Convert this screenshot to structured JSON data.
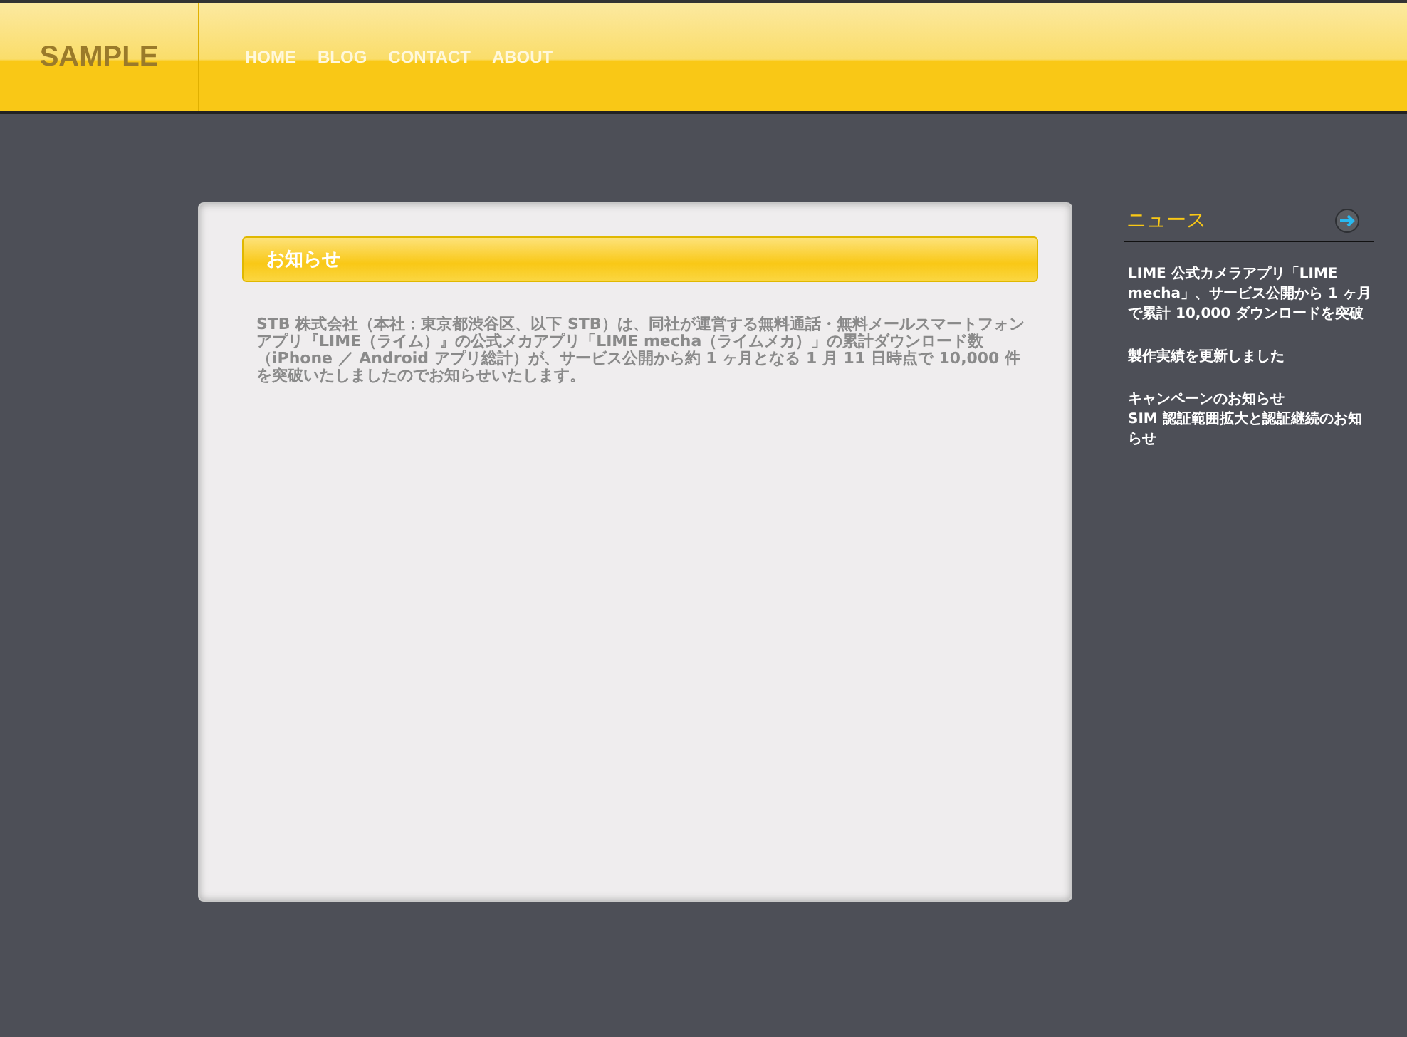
{
  "header": {
    "logo": "SAMPLE",
    "nav": [
      "HOME",
      "BLOG",
      "CONTACT",
      "ABOUT"
    ]
  },
  "notice": {
    "title": "お知らせ",
    "body": "STB 株式会社（本社：東京都渋谷区、以下 STB）は、同社が運営する無料通話・無料メールスマートフォンアプリ『LIME（ライム）』の公式メカアプリ「LIME mecha（ライムメカ）」の累計ダウンロード数（iPhone ／ Android アプリ総計）が、サービス公開から約 1 ヶ月となる 1 月 11 日時点で 10,000 件を突破いたしましたのでお知らせいたします。"
  },
  "news": {
    "title": "ニュース",
    "groups": [
      [
        "LIME 公式カメラアプリ「LIME mecha」、サービス公開から 1 ヶ月で累計 10,000 ダウンロードを突破"
      ],
      [
        "製作実績を更新しました"
      ],
      [
        "キャンペーンのお知らせ",
        "SIM 認証範囲拡大と認証継続のお知らせ"
      ]
    ]
  }
}
